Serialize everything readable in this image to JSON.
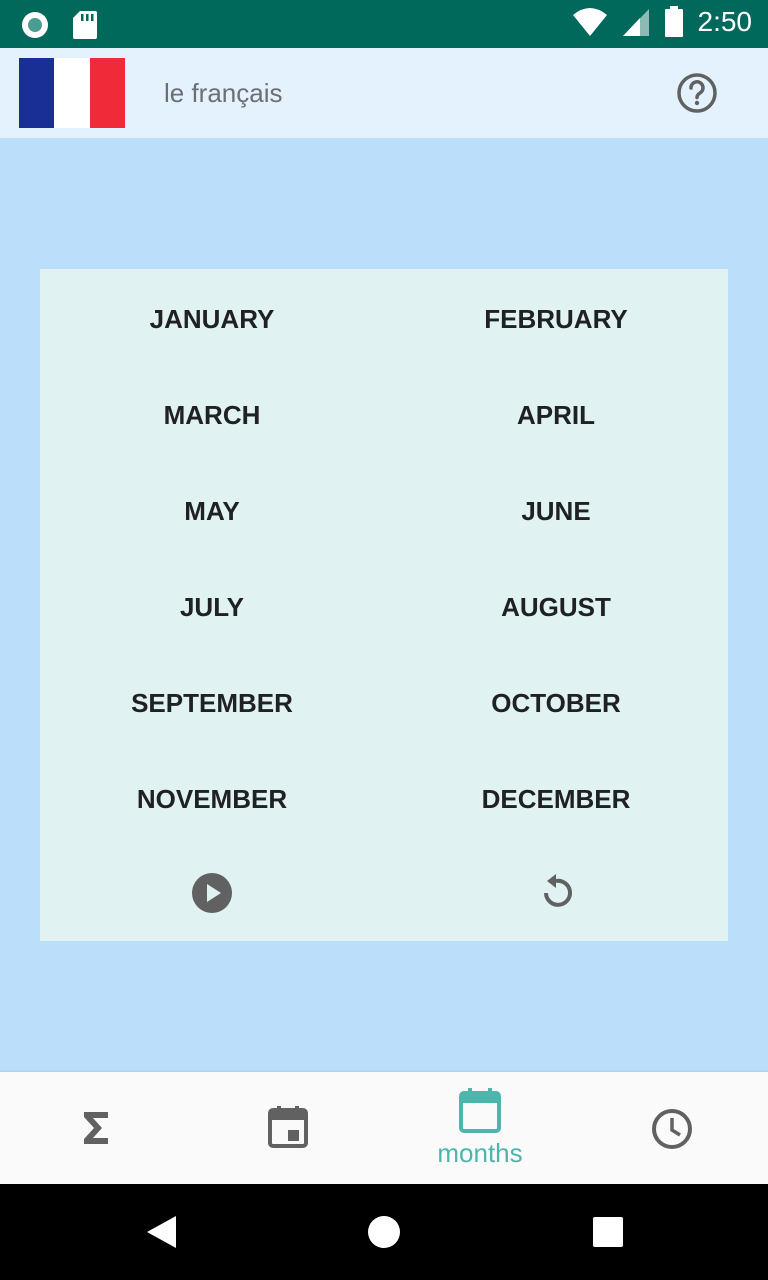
{
  "status_bar": {
    "time": "2:50",
    "icons": [
      "notification-dot-icon",
      "sd-card-icon",
      "wifi-icon",
      "signal-icon",
      "battery-icon"
    ]
  },
  "header": {
    "language_label": "le français",
    "flag": "france-flag",
    "help_icon": "help-circle-icon"
  },
  "months": [
    "JANUARY",
    "FEBRUARY",
    "MARCH",
    "APRIL",
    "MAY",
    "JUNE",
    "JULY",
    "AUGUST",
    "SEPTEMBER",
    "OCTOBER",
    "NOVEMBER",
    "DECEMBER"
  ],
  "controls": {
    "play_icon": "play-circle-icon",
    "replay_icon": "replay-icon"
  },
  "bottom_nav": {
    "items": [
      {
        "icon": "sigma-icon",
        "label": ""
      },
      {
        "icon": "calendar-day-icon",
        "label": ""
      },
      {
        "icon": "calendar-icon",
        "label": "months",
        "active": true
      },
      {
        "icon": "clock-icon",
        "label": ""
      }
    ],
    "active_color": "#4db6ac"
  },
  "colors": {
    "status_bar": "#00695c",
    "header": "#e3f2fd",
    "background": "#bbdefb",
    "card": "#e0f2f1"
  }
}
